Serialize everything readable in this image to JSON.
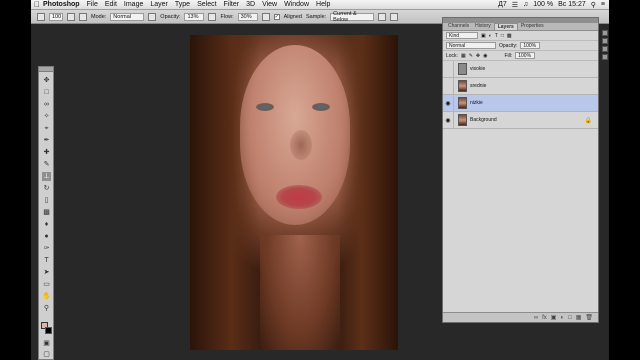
{
  "menubar": {
    "app_name": "Photoshop",
    "menus": [
      "File",
      "Edit",
      "Image",
      "Layer",
      "Type",
      "Select",
      "Filter",
      "3D",
      "View",
      "Window",
      "Help"
    ],
    "status": {
      "keyboard": "Д7",
      "battery": "100 %",
      "clock": "Вс 15:27"
    }
  },
  "options_bar": {
    "brush_size": "100",
    "mode_label": "Mode:",
    "mode_value": "Normal",
    "opacity_label": "Opacity:",
    "opacity_value": "13%",
    "flow_label": "Flow:",
    "flow_value": "30%",
    "aligned_label": "Aligned",
    "sample_label": "Sample:",
    "sample_value": "Current & Below"
  },
  "layers_panel": {
    "tabs": [
      {
        "label": "Channels",
        "active": false
      },
      {
        "label": "History",
        "active": false
      },
      {
        "label": "Layers",
        "active": true
      },
      {
        "label": "Properties",
        "active": false
      }
    ],
    "kind_label": "Kind",
    "blend_mode": "Normal",
    "opacity_label": "Opacity:",
    "opacity_value": "100%",
    "lock_label": "Lock:",
    "fill_label": "Fill:",
    "fill_value": "100%",
    "layers": [
      {
        "name": "visokie",
        "visible": false,
        "thumb": "grey",
        "selected": false,
        "locked": false
      },
      {
        "name": "srednie",
        "visible": false,
        "thumb": "photo",
        "selected": false,
        "locked": false
      },
      {
        "name": "nizkie",
        "visible": true,
        "thumb": "photo",
        "selected": true,
        "locked": false
      },
      {
        "name": "Background",
        "visible": true,
        "thumb": "photo",
        "selected": false,
        "locked": true
      }
    ]
  },
  "colors": {
    "foreground": "#d8b6ad",
    "background": "#000000",
    "workspace": "#282828",
    "selection": "#b9c8ea"
  }
}
